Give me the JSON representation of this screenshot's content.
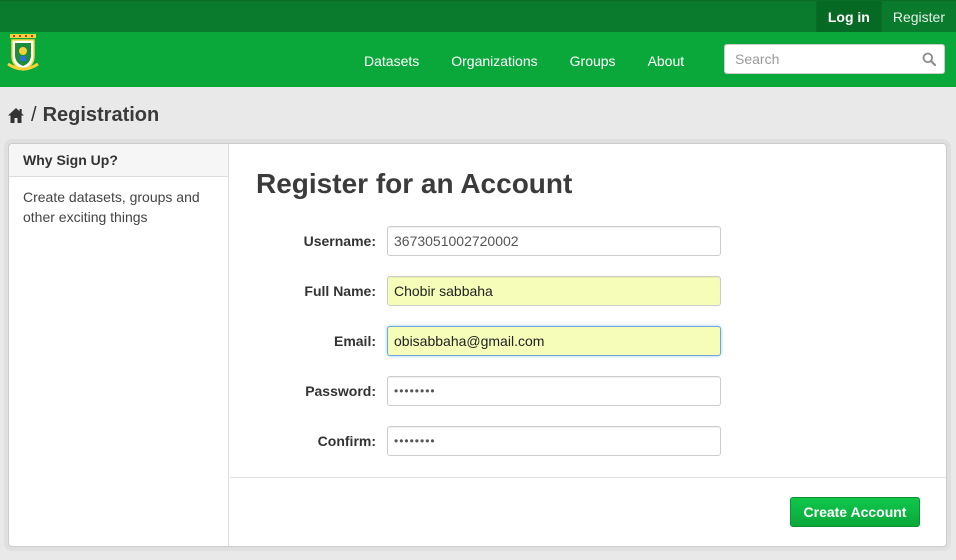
{
  "topbar": {
    "login_label": "Log in",
    "register_label": "Register"
  },
  "nav": {
    "items": [
      "Datasets",
      "Organizations",
      "Groups",
      "About"
    ]
  },
  "search": {
    "placeholder": "Search",
    "icon": "search-icon"
  },
  "breadcrumb": {
    "home_icon": "home-icon",
    "separator": "/",
    "current": "Registration"
  },
  "aside": {
    "heading": "Why Sign Up?",
    "body": "Create datasets, groups and other exciting things"
  },
  "form": {
    "title": "Register for an Account",
    "fields": [
      {
        "label": "Username:",
        "value": "3673051002720002"
      },
      {
        "label": "Full Name:",
        "value": "Chobir sabbaha"
      },
      {
        "label": "Email:",
        "value": "obisabbaha@gmail.com"
      },
      {
        "label": "Password:",
        "value": "••••••••"
      },
      {
        "label": "Confirm:",
        "value": "••••••••"
      }
    ],
    "submit_label": "Create Account"
  },
  "colors": {
    "topbar": "#0a7a2c",
    "masthead": "#0aa83b",
    "button": "#0aa83b",
    "autofill": "#f5fdb8"
  }
}
